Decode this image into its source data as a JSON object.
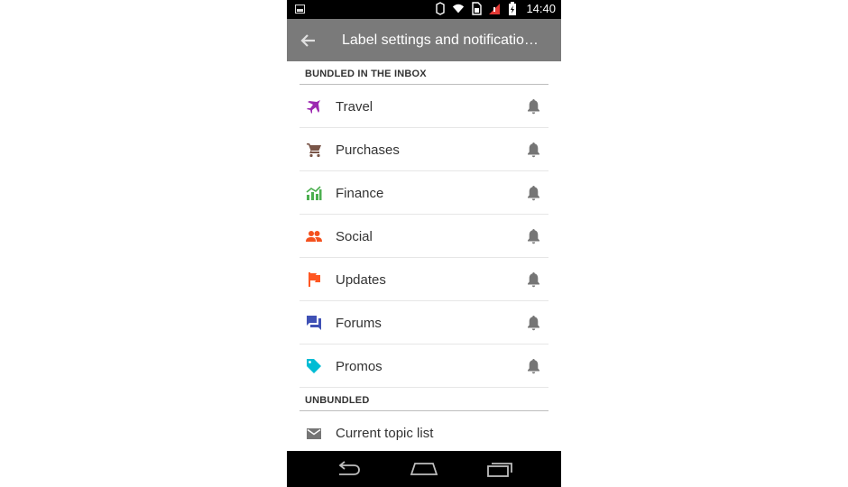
{
  "status_bar": {
    "time": "14:40"
  },
  "app_bar": {
    "title": "Label settings and notificatio…"
  },
  "sections": [
    {
      "header": "BUNDLED IN THE INBOX",
      "items": [
        {
          "label": "Travel",
          "icon": "airplane-icon",
          "color": "#9c27b0"
        },
        {
          "label": "Purchases",
          "icon": "cart-icon",
          "color": "#795548"
        },
        {
          "label": "Finance",
          "icon": "chart-icon",
          "color": "#4caf50"
        },
        {
          "label": "Social",
          "icon": "people-icon",
          "color": "#f4511e"
        },
        {
          "label": "Updates",
          "icon": "flag-icon",
          "color": "#ff5722"
        },
        {
          "label": "Forums",
          "icon": "forum-icon",
          "color": "#3f51b5"
        },
        {
          "label": "Promos",
          "icon": "tag-icon",
          "color": "#00bcd4"
        }
      ]
    },
    {
      "header": "UNBUNDLED",
      "items": [
        {
          "label": "Current topic list",
          "icon": "mail-icon",
          "color": "#757575"
        }
      ]
    }
  ],
  "colors": {
    "app_bar": "#7a7a7a",
    "bell": "#757575"
  }
}
